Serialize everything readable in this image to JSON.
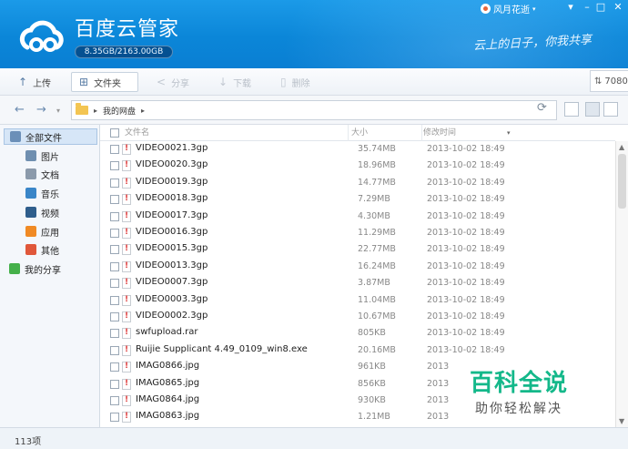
{
  "app": {
    "title": "百度云管家",
    "slogan": "云上的日子，你我共享"
  },
  "quota": {
    "text": "8.35GB/2163.00GB",
    "used_fraction": 0.004
  },
  "user": {
    "name": "风月花逝"
  },
  "toolbar": {
    "upload": "上传",
    "new_folder": "文件夹",
    "share": "分享",
    "download": "下载",
    "delete": "删除",
    "speed": "7080"
  },
  "path": {
    "root": "我的网盘"
  },
  "sidebar": {
    "items": [
      {
        "label": "全部文件",
        "icon": "drive-icon",
        "color": "#6b8fb8"
      },
      {
        "label": "图片",
        "icon": "picture-icon",
        "color": "#6f8fb0"
      },
      {
        "label": "文档",
        "icon": "document-icon",
        "color": "#8b9aab"
      },
      {
        "label": "音乐",
        "icon": "music-icon",
        "color": "#3a86c8"
      },
      {
        "label": "视频",
        "icon": "video-icon",
        "color": "#2f5e8c"
      },
      {
        "label": "应用",
        "icon": "app-icon",
        "color": "#f08a24"
      },
      {
        "label": "其他",
        "icon": "other-icon",
        "color": "#e0573a"
      },
      {
        "label": "我的分享",
        "icon": "share-icon",
        "color": "#45b04a"
      }
    ]
  },
  "columns": {
    "name": "文件名",
    "size": "大小",
    "date": "修改时间"
  },
  "files": [
    {
      "name": "VIDEO0021.3gp",
      "size": "35.74MB",
      "date": "2013-10-02 18:49"
    },
    {
      "name": "VIDEO0020.3gp",
      "size": "18.96MB",
      "date": "2013-10-02 18:49"
    },
    {
      "name": "VIDEO0019.3gp",
      "size": "14.77MB",
      "date": "2013-10-02 18:49"
    },
    {
      "name": "VIDEO0018.3gp",
      "size": "7.29MB",
      "date": "2013-10-02 18:49"
    },
    {
      "name": "VIDEO0017.3gp",
      "size": "4.30MB",
      "date": "2013-10-02 18:49"
    },
    {
      "name": "VIDEO0016.3gp",
      "size": "11.29MB",
      "date": "2013-10-02 18:49"
    },
    {
      "name": "VIDEO0015.3gp",
      "size": "22.77MB",
      "date": "2013-10-02 18:49"
    },
    {
      "name": "VIDEO0013.3gp",
      "size": "16.24MB",
      "date": "2013-10-02 18:49"
    },
    {
      "name": "VIDEO0007.3gp",
      "size": "3.87MB",
      "date": "2013-10-02 18:49"
    },
    {
      "name": "VIDEO0003.3gp",
      "size": "11.04MB",
      "date": "2013-10-02 18:49"
    },
    {
      "name": "VIDEO0002.3gp",
      "size": "10.67MB",
      "date": "2013-10-02 18:49"
    },
    {
      "name": "swfupload.rar",
      "size": "805KB",
      "date": "2013-10-02 18:49"
    },
    {
      "name": "Ruijie Supplicant 4.49_0109_win8.exe",
      "size": "20.16MB",
      "date": "2013-10-02 18:49"
    },
    {
      "name": "IMAG0866.jpg",
      "size": "961KB",
      "date": "2013"
    },
    {
      "name": "IMAG0865.jpg",
      "size": "856KB",
      "date": "2013"
    },
    {
      "name": "IMAG0864.jpg",
      "size": "930KB",
      "date": "2013"
    },
    {
      "name": "IMAG0863.jpg",
      "size": "1.21MB",
      "date": "2013"
    }
  ],
  "status": {
    "count": "113项"
  },
  "watermark": {
    "main": "百科全说",
    "sub": "助你轻松解决"
  }
}
